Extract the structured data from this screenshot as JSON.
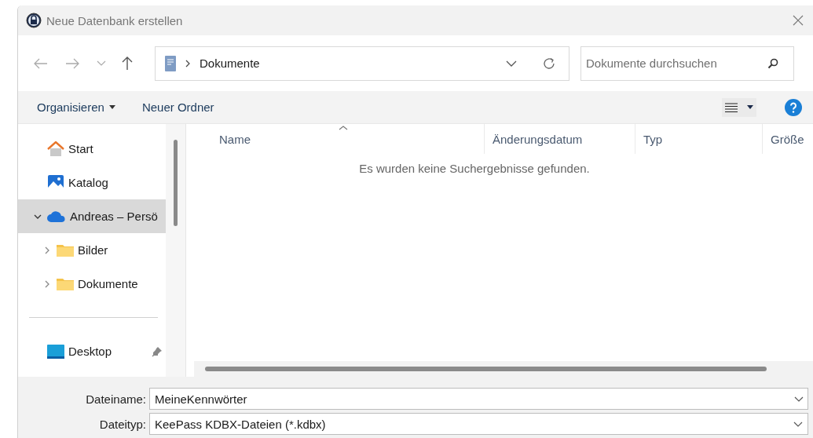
{
  "window": {
    "title": "Neue Datenbank erstellen"
  },
  "address_bar": {
    "path": "Dokumente"
  },
  "search": {
    "placeholder": "Dokumente durchsuchen"
  },
  "toolbar": [
    {
      "label": "Organisieren",
      "kind": "menu"
    },
    {
      "label": "Neuer Ordner",
      "kind": "button"
    }
  ],
  "sidebar": {
    "groups": [
      [
        {
          "label": "Start",
          "kind": "home",
          "selected": false
        },
        {
          "label": "Katalog",
          "kind": "gallery",
          "selected": false
        },
        {
          "label": "Andreas – Persö",
          "kind": "cloud",
          "selected": true,
          "expanded": true,
          "children": [
            {
              "label": "Bilder",
              "kind": "folder",
              "selected": false,
              "expanded": false
            },
            {
              "label": "Dokumente",
              "kind": "folder",
              "selected": false,
              "expanded": false
            }
          ]
        }
      ],
      [
        {
          "label": "Desktop",
          "kind": "desktop",
          "selected": false,
          "pinned": true
        }
      ]
    ]
  },
  "file_list": {
    "columns": [
      {
        "label": "Name",
        "sorted": true
      },
      {
        "label": "Änderungsdatum",
        "sorted": false
      },
      {
        "label": "Typ",
        "sorted": false
      },
      {
        "label": "Größe",
        "sorted": false
      }
    ],
    "empty_message": "Es wurden keine Suchergebnisse gefunden."
  },
  "filename": {
    "label": "Dateiname:",
    "value": "MeineKennwörter"
  },
  "filetype": {
    "label": "Dateityp:",
    "value": "KeePass KDBX-Dateien (*.kdbx)"
  }
}
